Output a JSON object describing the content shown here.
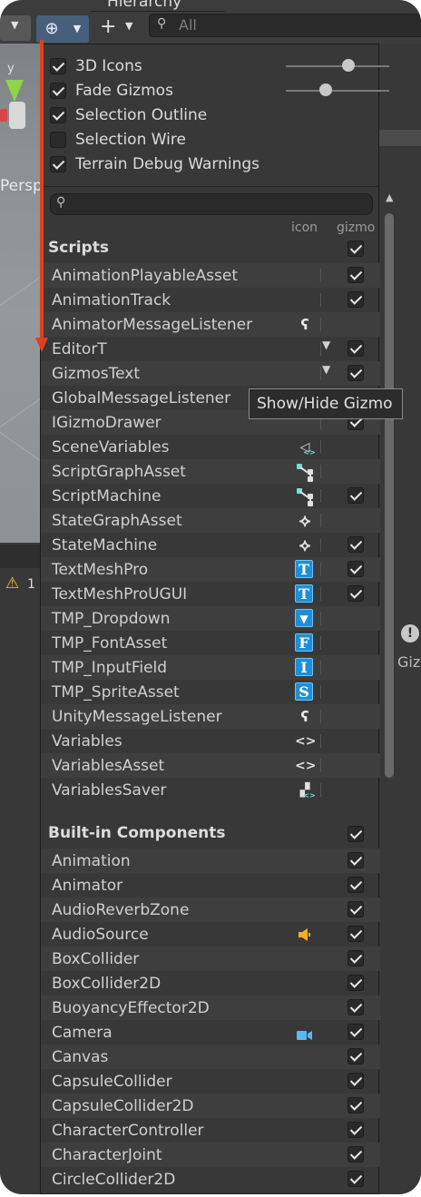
{
  "editor": {
    "hierarchy_tab": "Hierarchy",
    "search_placeholder": "All",
    "scene_axis_label": "y",
    "scene_camera_label": "Persp",
    "console_warning_count": "1",
    "inspector_partial_label": "Giz"
  },
  "gizmos_menu": {
    "options": [
      {
        "label": "3D Icons",
        "checked": true,
        "has_slider": true,
        "slider_level": 0.6
      },
      {
        "label": "Fade Gizmos",
        "checked": true,
        "has_slider": true,
        "slider_level": 0.38
      },
      {
        "label": "Selection Outline",
        "checked": true,
        "has_slider": false
      },
      {
        "label": "Selection Wire",
        "checked": false,
        "has_slider": false
      },
      {
        "label": "Terrain Debug Warnings",
        "checked": true,
        "has_slider": false
      }
    ],
    "search_value": "",
    "column_headers": {
      "icon": "icon",
      "gizmo": "gizmo"
    },
    "scripts_section": {
      "title": "Scripts",
      "header_checked": true,
      "items": [
        {
          "name": "AnimationPlayableAsset",
          "icon": "none",
          "checked": true,
          "has_dropdown": false
        },
        {
          "name": "AnimationTrack",
          "icon": "none",
          "checked": true,
          "has_dropdown": false
        },
        {
          "name": "AnimatorMessageListener",
          "icon": "ear-icon",
          "checked": null,
          "has_dropdown": false
        },
        {
          "name": "EditorT",
          "icon": "none",
          "checked": true,
          "has_dropdown": true
        },
        {
          "name": "GizmosText",
          "icon": "none",
          "checked": true,
          "has_dropdown": true
        },
        {
          "name": "GlobalMessageListener",
          "icon": "ear-icon",
          "checked": null,
          "has_dropdown": false
        },
        {
          "name": "IGizmoDrawer",
          "icon": "none",
          "checked": true,
          "has_dropdown": false
        },
        {
          "name": "SceneVariables",
          "icon": "scene-variables-icon",
          "checked": null,
          "has_dropdown": false
        },
        {
          "name": "ScriptGraphAsset",
          "icon": "script-graph-icon",
          "checked": null,
          "has_dropdown": false
        },
        {
          "name": "ScriptMachine",
          "icon": "script-graph-icon",
          "checked": true,
          "has_dropdown": false
        },
        {
          "name": "StateGraphAsset",
          "icon": "state-graph-icon",
          "checked": null,
          "has_dropdown": false
        },
        {
          "name": "StateMachine",
          "icon": "state-graph-icon",
          "checked": true,
          "has_dropdown": false
        },
        {
          "name": "TextMeshPro",
          "icon": "tmp-t-icon",
          "checked": true,
          "has_dropdown": false
        },
        {
          "name": "TextMeshProUGUI",
          "icon": "tmp-t-icon",
          "checked": true,
          "has_dropdown": false
        },
        {
          "name": "TMP_Dropdown",
          "icon": "tmp-dropdown-icon",
          "checked": null,
          "has_dropdown": false
        },
        {
          "name": "TMP_FontAsset",
          "icon": "tmp-f-icon",
          "checked": null,
          "has_dropdown": false
        },
        {
          "name": "TMP_InputField",
          "icon": "tmp-i-icon",
          "checked": null,
          "has_dropdown": false
        },
        {
          "name": "TMP_SpriteAsset",
          "icon": "tmp-s-icon",
          "checked": null,
          "has_dropdown": false
        },
        {
          "name": "UnityMessageListener",
          "icon": "ear-icon",
          "checked": null,
          "has_dropdown": false
        },
        {
          "name": "Variables",
          "icon": "variables-icon",
          "checked": null,
          "has_dropdown": false
        },
        {
          "name": "VariablesAsset",
          "icon": "variables-icon",
          "checked": null,
          "has_dropdown": false
        },
        {
          "name": "VariablesSaver",
          "icon": "variables-saver-icon",
          "checked": null,
          "has_dropdown": false
        }
      ]
    },
    "builtin_section": {
      "title": "Built-in Components",
      "header_checked": true,
      "items": [
        {
          "name": "Animation",
          "icon": "none",
          "checked": true
        },
        {
          "name": "Animator",
          "icon": "none",
          "checked": true
        },
        {
          "name": "AudioReverbZone",
          "icon": "none",
          "checked": true
        },
        {
          "name": "AudioSource",
          "icon": "speaker-icon",
          "checked": true
        },
        {
          "name": "BoxCollider",
          "icon": "none",
          "checked": true
        },
        {
          "name": "BoxCollider2D",
          "icon": "none",
          "checked": true
        },
        {
          "name": "BuoyancyEffector2D",
          "icon": "none",
          "checked": true
        },
        {
          "name": "Camera",
          "icon": "camera-icon",
          "checked": true
        },
        {
          "name": "Canvas",
          "icon": "none",
          "checked": true
        },
        {
          "name": "CapsuleCollider",
          "icon": "none",
          "checked": true
        },
        {
          "name": "CapsuleCollider2D",
          "icon": "none",
          "checked": true
        },
        {
          "name": "CharacterController",
          "icon": "none",
          "checked": true
        },
        {
          "name": "CharacterJoint",
          "icon": "none",
          "checked": true
        },
        {
          "name": "CircleCollider2D",
          "icon": "none",
          "checked": true
        }
      ]
    },
    "tooltip": "Show/Hide Gizmo"
  },
  "colors": {
    "panel_bg": "#383838",
    "row_alt": "#3e3e3e",
    "tmp_blue": "#1e8fd6",
    "graph_teal": "#6fe3d2",
    "speaker_yellow": "#f0b020",
    "camera_blue": "#5ab8ef",
    "annotation_red": "#e0401c"
  }
}
